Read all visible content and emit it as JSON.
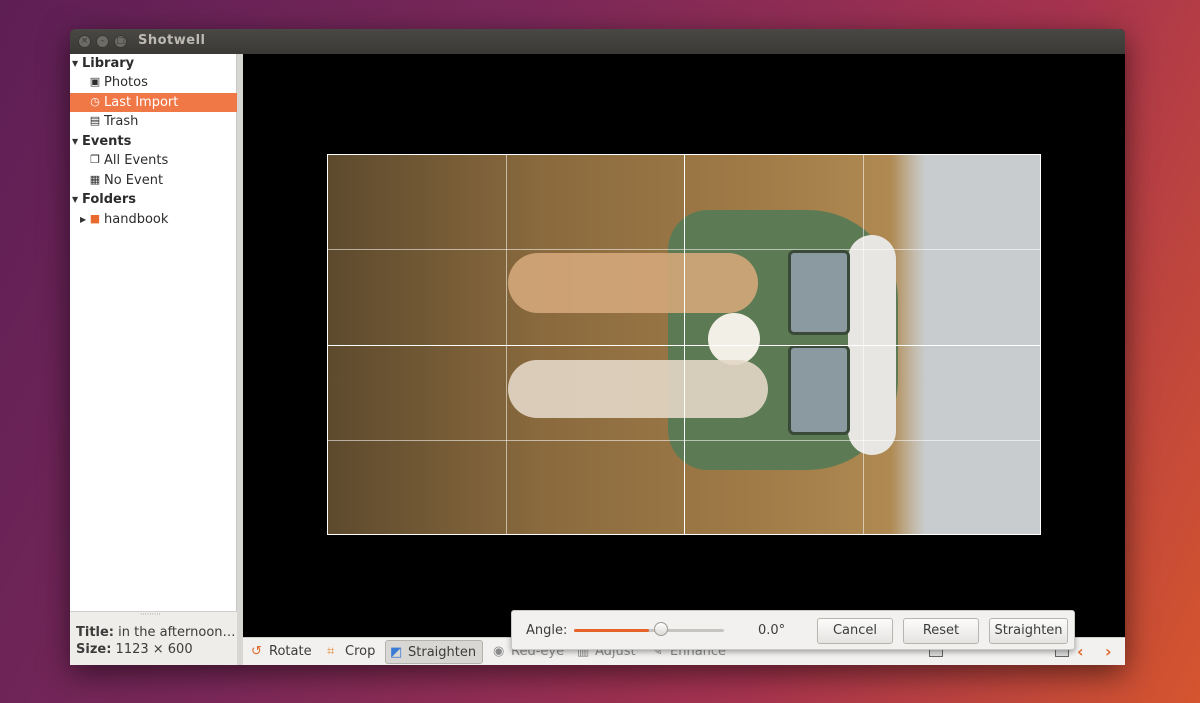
{
  "window": {
    "title": "Shotwell"
  },
  "sidebar": {
    "items": [
      {
        "label": "Library",
        "type": "header",
        "icon": "expander-open"
      },
      {
        "label": "Photos",
        "type": "item",
        "icon": "photos-icon"
      },
      {
        "label": "Last Import",
        "type": "item",
        "icon": "last-import-icon",
        "selected": true
      },
      {
        "label": "Trash",
        "type": "item",
        "icon": "trash-icon"
      },
      {
        "label": "Events",
        "type": "header",
        "icon": "expander-open"
      },
      {
        "label": "All Events",
        "type": "item",
        "icon": "events-icon"
      },
      {
        "label": "No Event",
        "type": "item",
        "icon": "no-event-icon"
      },
      {
        "label": "Folders",
        "type": "header",
        "icon": "expander-open"
      },
      {
        "label": "handbook",
        "type": "item",
        "icon": "folder-icon"
      }
    ]
  },
  "info": {
    "title_label": "Title:",
    "title_value": "in the afternoon…",
    "size_label": "Size:",
    "size_value": "1123 × 600"
  },
  "toolbar": {
    "rotate": "Rotate",
    "crop": "Crop",
    "straighten": "Straighten",
    "redeye": "Red-eye",
    "adjust": "Adjust",
    "enhance": "Enhance"
  },
  "straighten_popover": {
    "angle_label": "Angle:",
    "angle_value": "0.0°",
    "slider_level": 0.5,
    "cancel": "Cancel",
    "reset": "Reset",
    "apply": "Straighten"
  },
  "colors": {
    "accent": "#f07746",
    "slider_fill": "#e8632a",
    "nav_arrow": "#e06a2c"
  }
}
